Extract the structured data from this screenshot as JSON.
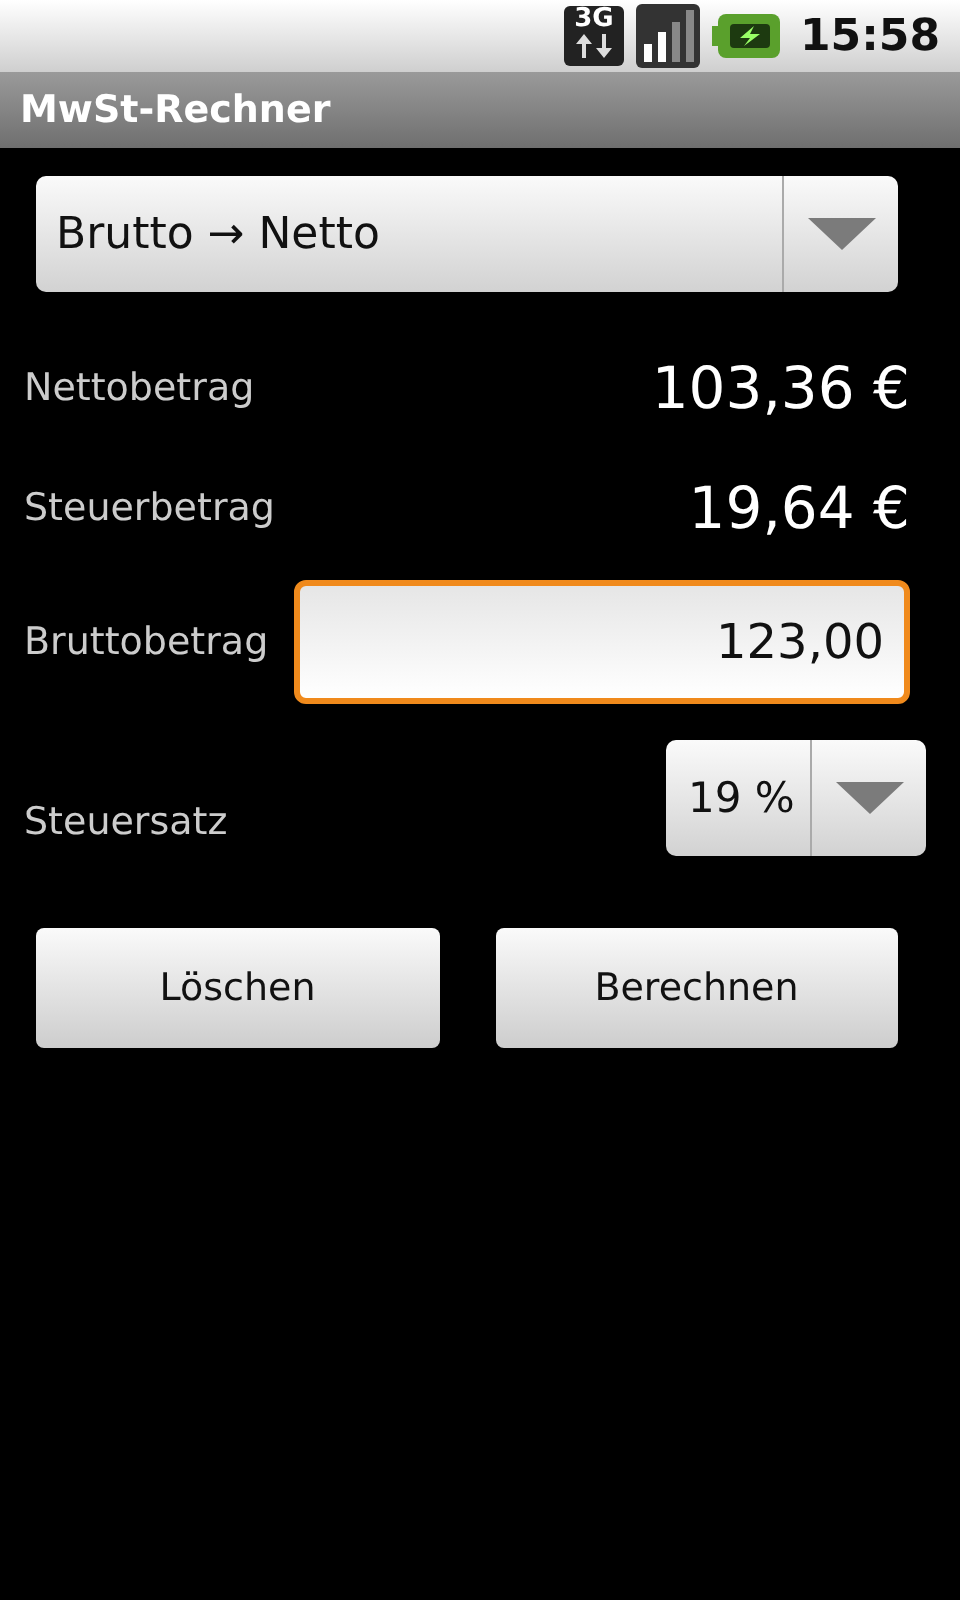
{
  "status_bar": {
    "network": "3G",
    "time": "15:58"
  },
  "title_bar": {
    "title": "MwSt-Rechner"
  },
  "mode_spinner": {
    "value": "Brutto → Netto"
  },
  "results": [
    {
      "label": "Nettobetrag",
      "value": "103,36 €"
    },
    {
      "label": "Steuerbetrag",
      "value": "19,64 €"
    }
  ],
  "gross_field": {
    "label": "Bruttobetrag",
    "value": "123,00",
    "focused": true
  },
  "rate": {
    "label": "Steuersatz",
    "value": "19 %"
  },
  "buttons": [
    "Löschen",
    "Berechnen"
  ]
}
